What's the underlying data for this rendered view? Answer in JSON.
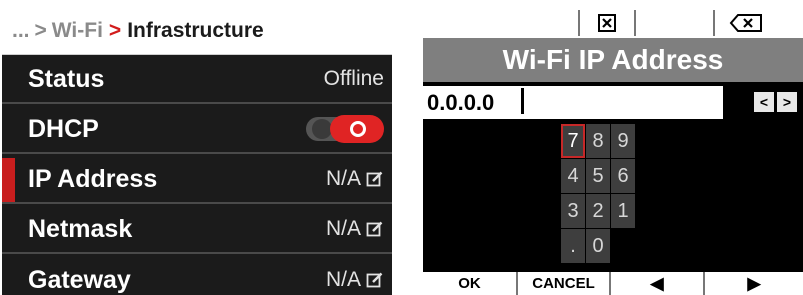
{
  "menu": {
    "breadcrumb": {
      "ellipsis": "...",
      "separator_1": ">",
      "parent": "Wi-Fi",
      "separator_2": ">",
      "current": "Infrastructure"
    },
    "rows": [
      {
        "label": "Status",
        "value": "Offline"
      },
      {
        "label": "DHCP",
        "value_kind": "toggle",
        "toggle_state": "on"
      },
      {
        "label": "IP Address",
        "value": "N/A",
        "selected": true,
        "editable": true
      },
      {
        "label": "Netmask",
        "value": "N/A",
        "editable": true
      },
      {
        "label": "Gateway",
        "value": "N/A",
        "editable": true
      }
    ],
    "icons": {
      "edit": "edit-pencil-icon"
    }
  },
  "keyboard": {
    "title": "Wi-Fi IP Address",
    "value": "0.0.0.0",
    "top_icons": [
      "clear-box-icon",
      "backspace-icon"
    ],
    "nav": {
      "left": "<",
      "right": ">"
    },
    "keys": [
      "7",
      "8",
      "9",
      "4",
      "5",
      "6",
      "3",
      "2",
      "1",
      ".",
      "0"
    ],
    "selected_key": "7",
    "bottom": {
      "ok": "OK",
      "cancel": "CANCEL",
      "prev": "◀",
      "next": "▶"
    }
  },
  "colors": {
    "accent_red": "#d21c1c",
    "panel_bg": "#1b1b1b",
    "keypad_key": "#3e3e3e",
    "title_bar": "#7f7f7f"
  }
}
